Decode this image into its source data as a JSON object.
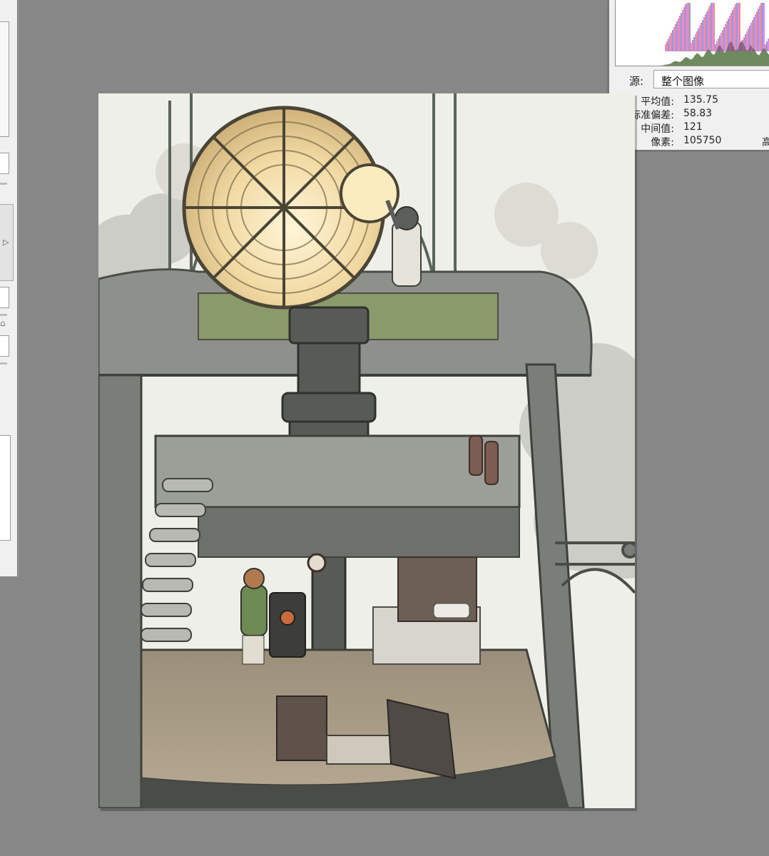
{
  "histogram": {
    "source_label": "源:",
    "source_value": "整个图像",
    "stats": [
      {
        "label": "平均值:",
        "value": "135.75"
      },
      {
        "label": "标准偏差:",
        "value": "58.83"
      },
      {
        "label": "中间值:",
        "value": "121"
      },
      {
        "label": "像素:",
        "value": "105750",
        "extra": "高"
      }
    ],
    "colors": {
      "luminosity_fill": "#6f8a5e",
      "channels": [
        "#e63c3c",
        "#3cb44a",
        "#3a5fd9",
        "#e6d23c",
        "#d23cd2",
        "#3cd2d2"
      ]
    }
  },
  "canvas": {
    "description_icons": [
      "lighthouse-lamp",
      "stove",
      "bed",
      "staircase"
    ],
    "colors": {
      "sky": "#efefe9",
      "stone": "#8a8c86",
      "stone_dark": "#5d605a",
      "lamp_glow": "#f4dfb0",
      "wood_floor": "#a89a86",
      "moss": "#8b9a6a"
    }
  }
}
